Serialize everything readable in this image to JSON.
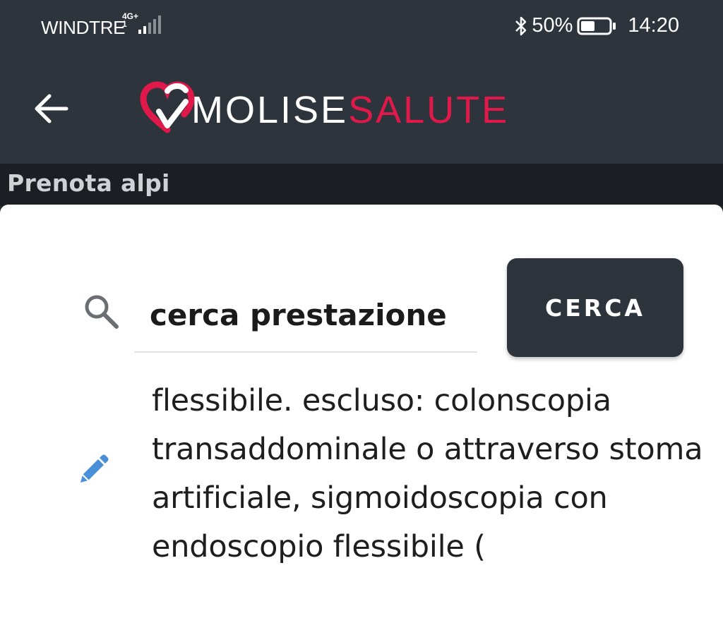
{
  "status_bar": {
    "carrier": "WINDTRE",
    "network_type": "4G+",
    "network_sub": "1",
    "battery_percent": "50%",
    "battery_level": 0.5,
    "time": "14:20",
    "icons": [
      "signal-icon",
      "bluetooth-icon",
      "battery-icon"
    ]
  },
  "app_bar": {
    "back_icon": "arrow-left-icon",
    "logo": {
      "part1": "MOLISE",
      "part2": "SALUTE",
      "heart_color": "#e0194a",
      "text_accent_color": "#e0194a"
    }
  },
  "section": {
    "title": "Prenota alpi"
  },
  "search": {
    "icon": "search-icon",
    "placeholder": "cerca prestazione",
    "value": "",
    "button_label": "CERCA"
  },
  "result": {
    "icon": "pencil-icon",
    "text": "flessibile. escluso: colonscopia transaddominale o attraverso stoma artificiale, sigmoidoscopia con endoscopio flessibile ("
  },
  "colors": {
    "header_bg": "#2d343b",
    "section_bg": "#1b1f24",
    "accent": "#e0194a",
    "edit_icon": "#4a90d9"
  }
}
